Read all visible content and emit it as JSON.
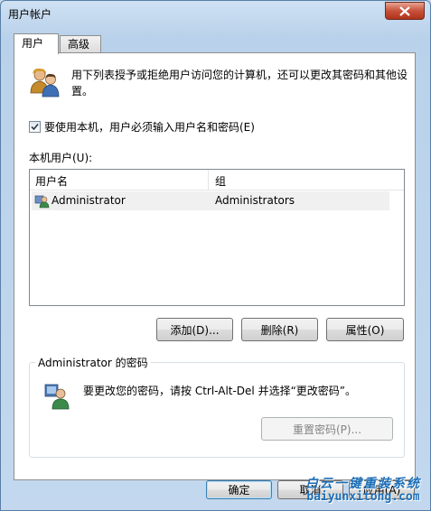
{
  "window": {
    "title": "用户帐户"
  },
  "tabs": [
    {
      "label": "用户",
      "active": true
    },
    {
      "label": "高级",
      "active": false
    }
  ],
  "intro": {
    "text": "用下列表授予或拒绝用户访问您的计算机，还可以更改其密码和其他设置。",
    "icon": "users-icon"
  },
  "require_login": {
    "label": "要使用本机，用户必须输入用户名和密码(E)",
    "checked": true
  },
  "local_users": {
    "label": "本机用户(U):",
    "columns": [
      "用户名",
      "组"
    ],
    "rows": [
      {
        "name": "Administrator",
        "group": "Administrators",
        "icon": "user-icon"
      }
    ]
  },
  "actions": {
    "add": "添加(D)...",
    "remove": "删除(R)",
    "properties": "属性(O)"
  },
  "password_section": {
    "title": "Administrator 的密码",
    "text": "要更改您的密码，请按 Ctrl-Alt-Del 并选择“更改密码”。",
    "reset_button": "重置密码(P)...",
    "reset_enabled": false,
    "icon": "user-key-icon"
  },
  "dialog_buttons": {
    "ok": "确定",
    "cancel": "取消",
    "apply": "应用(A)"
  },
  "watermark": {
    "name": "白云一键重装系统",
    "url": "baiyunxitong.com"
  },
  "colors": {
    "accent": "#3c7fb1",
    "close": "#c7513a",
    "watermark": "#1d6fb8"
  }
}
